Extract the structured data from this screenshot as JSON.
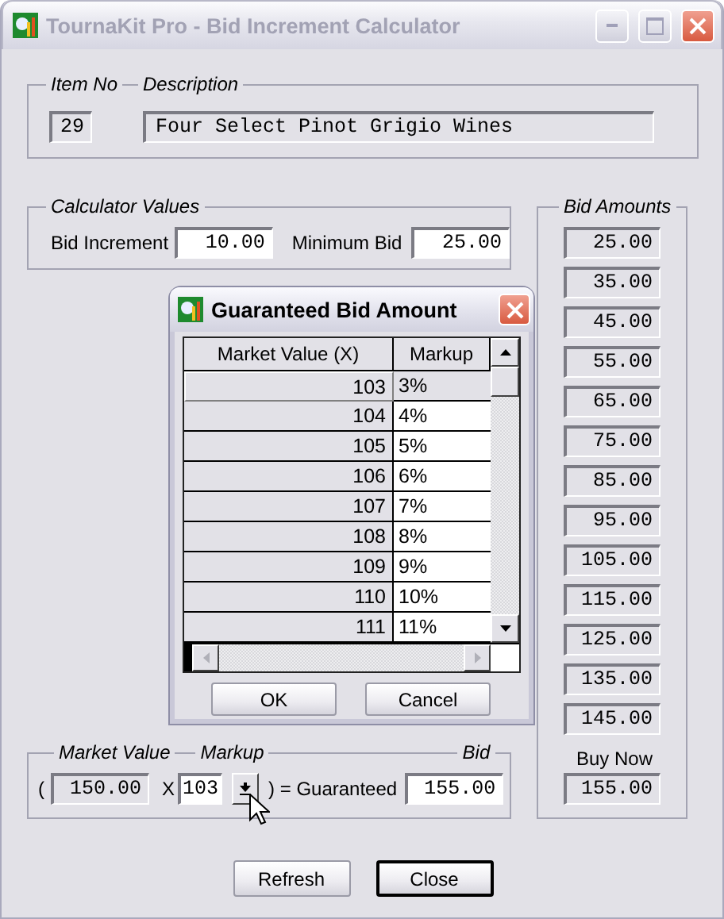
{
  "window": {
    "title": "TournaKit Pro - Bid Increment Calculator"
  },
  "item": {
    "item_no_label": "Item No",
    "description_label": "Description",
    "item_no": "29",
    "description": "Four Select Pinot Grigio Wines"
  },
  "calculator": {
    "title": "Calculator Values",
    "bid_increment_label": "Bid Increment",
    "bid_increment": "10.00",
    "minimum_bid_label": "Minimum Bid",
    "minimum_bid": "25.00"
  },
  "bid_amounts": {
    "title": "Bid Amounts",
    "values": [
      "25.00",
      "35.00",
      "45.00",
      "55.00",
      "65.00",
      "75.00",
      "85.00",
      "95.00",
      "105.00",
      "115.00",
      "125.00",
      "135.00",
      "145.00"
    ],
    "buy_now_label": "Buy Now",
    "buy_now": "155.00"
  },
  "guarantee": {
    "market_value_label": "Market Value",
    "markup_label": "Markup",
    "bid_label": "Bid",
    "open_paren": "(",
    "market_value": "150.00",
    "times": "X",
    "markup": "103",
    "equals": ") = Guaranteed",
    "bid": "155.00"
  },
  "buttons": [
    {
      "label": "Refresh",
      "default": false
    },
    {
      "label": "Close",
      "default": true
    }
  ],
  "dialog": {
    "title": "Guaranteed Bid Amount",
    "columns": [
      "Market Value (X)",
      "Markup"
    ],
    "rows": [
      {
        "market_value": "103",
        "markup": "3%",
        "selected": true
      },
      {
        "market_value": "104",
        "markup": "4%",
        "selected": false
      },
      {
        "market_value": "105",
        "markup": "5%",
        "selected": false
      },
      {
        "market_value": "106",
        "markup": "6%",
        "selected": false
      },
      {
        "market_value": "107",
        "markup": "7%",
        "selected": false
      },
      {
        "market_value": "108",
        "markup": "8%",
        "selected": false
      },
      {
        "market_value": "109",
        "markup": "9%",
        "selected": false
      },
      {
        "market_value": "110",
        "markup": "10%",
        "selected": false
      },
      {
        "market_value": "111",
        "markup": "11%",
        "selected": false
      }
    ],
    "buttons": [
      "OK",
      "Cancel"
    ]
  }
}
